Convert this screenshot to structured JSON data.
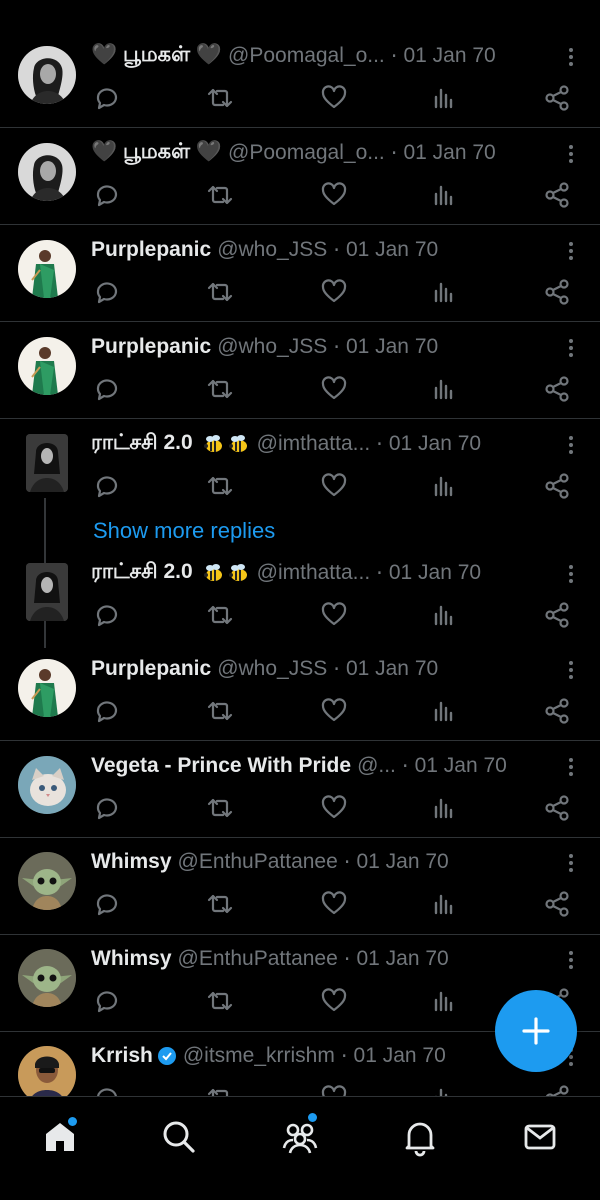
{
  "tweets": [
    {
      "name": "🖤 பூமகள் 🖤",
      "handle": "@Poomagal_o...",
      "dot": "·",
      "time": "01 Jan 70",
      "avatar": "girl-portrait-bw"
    },
    {
      "name": "🖤 பூமகள் 🖤",
      "handle": "@Poomagal_o...",
      "dot": "·",
      "time": "01 Jan 70",
      "avatar": "girl-portrait-bw"
    },
    {
      "name": "Purplepanic",
      "handle": "@who_JSS",
      "dot": "·",
      "time": "01 Jan 70",
      "avatar": "woman-green-saree"
    },
    {
      "name": "Purplepanic",
      "handle": "@who_JSS",
      "dot": "·",
      "time": "01 Jan 70",
      "avatar": "woman-green-saree"
    },
    {
      "name": "ராட்சசி 2.0",
      "handle": "@imthatta...",
      "dot": "·",
      "time": "01 Jan 70",
      "avatar": "woman-bw-photo"
    },
    {
      "name": "ராட்சசி 2.0",
      "handle": "@imthatta...",
      "dot": "·",
      "time": "01 Jan 70",
      "avatar": "woman-bw-photo"
    },
    {
      "name": "Purplepanic",
      "handle": "@who_JSS",
      "dot": "·",
      "time": "01 Jan 70",
      "avatar": "woman-green-saree"
    },
    {
      "name": "Vegeta - Prince With Pride",
      "handle": "@...",
      "dot": "·",
      "time": "01 Jan 70",
      "avatar": "cat-photo"
    },
    {
      "name": "Whimsy",
      "handle": "@EnthuPattanee",
      "dot": "·",
      "time": "01 Jan 70",
      "avatar": "baby-yoda"
    },
    {
      "name": "Whimsy",
      "handle": "@EnthuPattanee",
      "dot": "·",
      "time": "01 Jan 70",
      "avatar": "baby-yoda"
    },
    {
      "name": "Krrish",
      "handle": "@itsme_krrishm",
      "dot": "·",
      "time": "01 Jan 70",
      "avatar": "man-portrait",
      "verified": true
    }
  ],
  "show_more_replies": "Show more replies",
  "colors": {
    "accent": "#1d9bf0",
    "muted": "#71767b",
    "text": "#e7e9ea",
    "background": "#000000",
    "divider": "#2f3336"
  },
  "actions": [
    "reply-icon",
    "retweet-icon",
    "like-icon",
    "views-icon",
    "share-icon"
  ],
  "nav": [
    "home-icon",
    "search-icon",
    "communities-icon",
    "notifications-icon",
    "messages-icon"
  ],
  "fab": "compose-plus-icon"
}
